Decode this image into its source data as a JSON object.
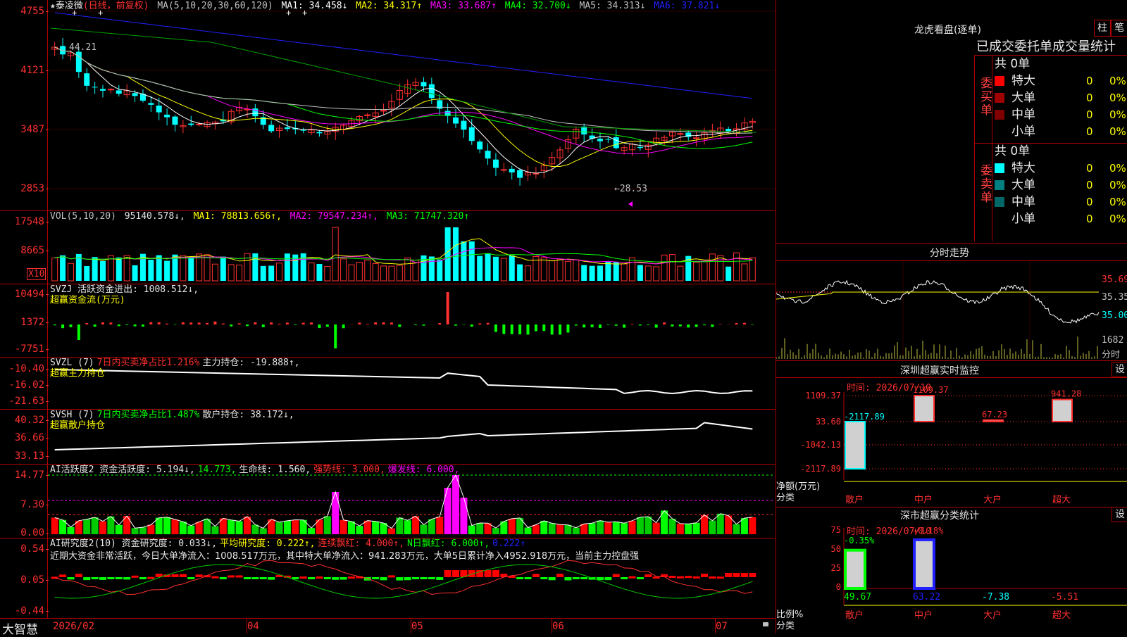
{
  "colors": {
    "up": "#ff3030",
    "down": "#00ffff",
    "green": "#00ff00",
    "magenta": "#ff00ff",
    "yellow": "#ffff00",
    "white": "#ffffff",
    "blue": "#2020ff",
    "grid": "#b00000"
  },
  "main": {
    "label_stock": "★泰凌微",
    "label_period": "(日线，前复权)",
    "ma_title": "MA(5,10,20,30,60,120)",
    "ma": [
      {
        "text": "MA1: 34.458↓",
        "color": "#ffffff"
      },
      {
        "text": "MA2: 34.317↑",
        "color": "#ffff00"
      },
      {
        "text": "MA3: 33.687↑",
        "color": "#ff00ff"
      },
      {
        "text": "MA4: 32.700↓",
        "color": "#00ff00"
      },
      {
        "text": "MA5: 34.313↓",
        "color": "#c0c0c0"
      },
      {
        "text": "MA6: 37.821↓",
        "color": "#2020ff"
      }
    ],
    "ticks": [
      "4755",
      "4121",
      "3487",
      "2853"
    ],
    "high_label": "44.21",
    "low_label": "←28.53"
  },
  "vol": {
    "title": "VOL(5,10,20)",
    "value": "95140.578↓,",
    "ma": [
      {
        "text": "MA1: 78813.656↑,",
        "color": "#ffff00"
      },
      {
        "text": "MA2: 79547.234↑,",
        "color": "#ff00ff"
      },
      {
        "text": "MA3: 71747.320↑",
        "color": "#00ff00"
      }
    ],
    "ticks": [
      "17548",
      "8665"
    ],
    "unit": "X10"
  },
  "svzj": {
    "title": "SVZJ  活跃资金进出: 1008.512↓,",
    "sub": "超赢资金流(万元)",
    "ticks": [
      "10494",
      "1372",
      "-7751"
    ]
  },
  "svzl": {
    "title": "SVZL (7)",
    "t2": "7日内买卖净占比1.216%",
    "t3": "主力持仓: -19.888↑,",
    "sub": "超赢主力持仓",
    "ticks": [
      "-10.40",
      "-16.02",
      "-21.63"
    ]
  },
  "svsh": {
    "title": "SVSH (7)",
    "t2": "7日内买卖净占比1.487%",
    "t3": "散户持仓: 38.172↓,",
    "sub": "超赢散户持仓",
    "ticks": [
      "40.32",
      "36.66",
      "33.13"
    ]
  },
  "ai1": {
    "parts": [
      {
        "text": "AI活跃度2 资金活跃度: 5.194↓,",
        "color": "#e6e6e6"
      },
      {
        "text": "14.773,",
        "color": "#00ff00"
      },
      {
        "text": "生命线: 1.560,",
        "color": "#e6e6e6"
      },
      {
        "text": "强势线: 3.000,",
        "color": "#ff3030"
      },
      {
        "text": "爆发线: 6.000,",
        "color": "#ff00ff"
      }
    ],
    "ticks": [
      "14.77",
      "7.30",
      "0.00"
    ]
  },
  "ai2": {
    "parts": [
      {
        "text": "AI研究度2(10) 资金研究度: 0.033↓,",
        "color": "#e6e6e6"
      },
      {
        "text": "平均研究度: 0.222↑,",
        "color": "#ffff00"
      },
      {
        "text": "连续飘红: 4.000↑,",
        "color": "#ff3030"
      },
      {
        "text": "N日飘红: 6.000↑,",
        "color": "#00ff00"
      },
      {
        "text": "0.222↑",
        "color": "#2020ff"
      }
    ],
    "line2": "近期大资金非常活跃，今日大单净流入：1008.517万元，其中特大单净流入：941.283万元，大单5日累计净入4952.918万元，当前主力控盘强",
    "ticks": [
      "0.54",
      "0.05",
      "-0.44"
    ]
  },
  "xaxis": {
    "brand": "大智慧",
    "dates": [
      "2026/02",
      "04",
      "05",
      "06",
      "07"
    ]
  },
  "right": {
    "lhb_title": "龙虎看盘(逐单)",
    "btn1": "柱",
    "btn2": "笔",
    "stat_title": "已成交委托单成交量统计",
    "buy_label": "委买单",
    "sell_label": "委卖单",
    "buy_total": "共 0单",
    "sell_total": "共 0单",
    "buy_rows": [
      {
        "name": "特大",
        "v": "0",
        "p": "0%",
        "c": "#ff0000"
      },
      {
        "name": "大单",
        "v": "0",
        "p": "0%",
        "c": "#a00000"
      },
      {
        "name": "中单",
        "v": "0",
        "p": "0%",
        "c": "#800000"
      },
      {
        "name": "小单",
        "v": "0",
        "p": "0%",
        "c": "#000000"
      }
    ],
    "sell_rows": [
      {
        "name": "特大",
        "v": "0",
        "p": "0%",
        "c": "#00ffff"
      },
      {
        "name": "大单",
        "v": "0",
        "p": "0%",
        "c": "#008080"
      },
      {
        "name": "中单",
        "v": "0",
        "p": "0%",
        "c": "#006666"
      },
      {
        "name": "小单",
        "v": "0",
        "p": "0%",
        "c": "#000000"
      }
    ],
    "ft_title": "分时走势",
    "ft_ticks": [
      "35.69",
      "35.35",
      "35.00"
    ],
    "ft_vol": "1682",
    "ft_label": "分时",
    "sz_title": "深圳超赢实时监控",
    "set": "设",
    "sz_time": "时间: 2026/07/10",
    "sz_ticks": [
      "1109.37",
      "33.60",
      "-1042.13",
      "-2117.89"
    ],
    "sz_bars": [
      {
        "label": "-2117.89",
        "color": "#00ffff"
      },
      {
        "label": "1109.37",
        "color": "#ff3030"
      },
      {
        "label": "67.23",
        "color": "#ff3030"
      },
      {
        "label": "941.28",
        "color": "#ff3030"
      }
    ],
    "sz_yl1": "净额(万元)",
    "sz_yl2": "分类",
    "cats": [
      "散户",
      "中户",
      "大户",
      "超大"
    ],
    "cls_title": "深市超赢分类统计",
    "cls_time": "时间: 2026/07/10",
    "cls_ticks": [
      "75",
      "50",
      "25",
      "0"
    ],
    "cls_top": [
      {
        "text": "-0.35%",
        "color": "#00ff00"
      },
      {
        "text": "+0.18%",
        "color": "#ff3030"
      }
    ],
    "cls_bottom": [
      {
        "text": "49.67",
        "color": "#00ff00"
      },
      {
        "text": "63.22",
        "color": "#2020ff"
      },
      {
        "text": "-7.38",
        "color": "#00ffff"
      },
      {
        "text": "-5.51",
        "color": "#ff3030"
      }
    ],
    "cls_yl1": "比例%",
    "cls_yl2": "分类"
  }
}
